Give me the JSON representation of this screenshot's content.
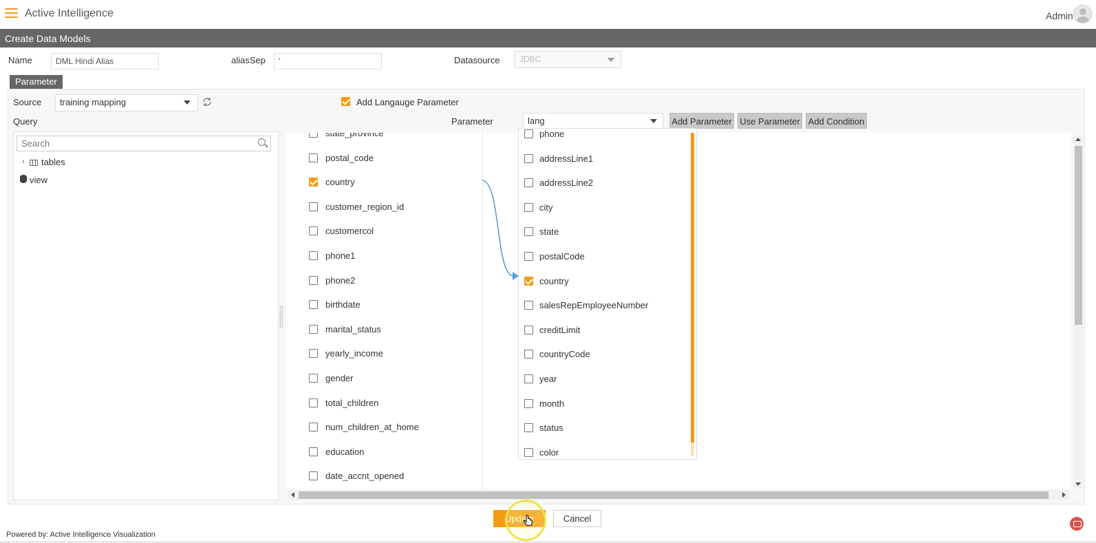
{
  "app": {
    "title": "Active Intelligence",
    "user": "Admin"
  },
  "page": {
    "title": "Create Data Models"
  },
  "form": {
    "name_label": "Name",
    "name_value": "DML Hindi Alias",
    "alias_sep_label": "aliasSep",
    "alias_sep_value": "'",
    "datasource_label": "Datasource",
    "datasource_value": "JDBC"
  },
  "parameter_tab": "Parameter",
  "panel": {
    "source_label": "Source",
    "source_value": "training mapping",
    "query_label": "Query",
    "add_language_label": "Add Langauge Parameter",
    "parameter_label": "Parameter",
    "parameter_value": "lang",
    "buttons": {
      "add_parameter": "Add Parameter",
      "use_parameter": "Use Parameter",
      "add_condition": "Add Condition"
    }
  },
  "tree": {
    "search_placeholder": "Search",
    "items": [
      {
        "label": "tables"
      },
      {
        "label": "view"
      }
    ]
  },
  "left_columns": [
    {
      "label": "state_province",
      "checked": false
    },
    {
      "label": "postal_code",
      "checked": false
    },
    {
      "label": "country",
      "checked": true
    },
    {
      "label": "customer_region_id",
      "checked": false
    },
    {
      "label": "customercol",
      "checked": false
    },
    {
      "label": "phone1",
      "checked": false
    },
    {
      "label": "phone2",
      "checked": false
    },
    {
      "label": "birthdate",
      "checked": false
    },
    {
      "label": "marital_status",
      "checked": false
    },
    {
      "label": "yearly_income",
      "checked": false
    },
    {
      "label": "gender",
      "checked": false
    },
    {
      "label": "total_children",
      "checked": false
    },
    {
      "label": "num_children_at_home",
      "checked": false
    },
    {
      "label": "education",
      "checked": false
    },
    {
      "label": "date_accnt_opened",
      "checked": false
    }
  ],
  "right_columns": [
    {
      "label": "phone",
      "checked": false
    },
    {
      "label": "addressLine1",
      "checked": false
    },
    {
      "label": "addressLine2",
      "checked": false
    },
    {
      "label": "city",
      "checked": false
    },
    {
      "label": "state",
      "checked": false
    },
    {
      "label": "postalCode",
      "checked": false
    },
    {
      "label": "country",
      "checked": true
    },
    {
      "label": "salesRepEmployeeNumber",
      "checked": false
    },
    {
      "label": "creditLimit",
      "checked": false
    },
    {
      "label": "countryCode",
      "checked": false
    },
    {
      "label": "year",
      "checked": false
    },
    {
      "label": "month",
      "checked": false
    },
    {
      "label": "status",
      "checked": false
    },
    {
      "label": "color",
      "checked": false
    }
  ],
  "actions": {
    "update": "Update",
    "cancel": "Cancel"
  },
  "footer": {
    "text": "Powered by: Active Intelligence Visualization"
  },
  "colors": {
    "accent": "#f39c12",
    "header": "#666666",
    "connector": "#5b9bd5"
  }
}
